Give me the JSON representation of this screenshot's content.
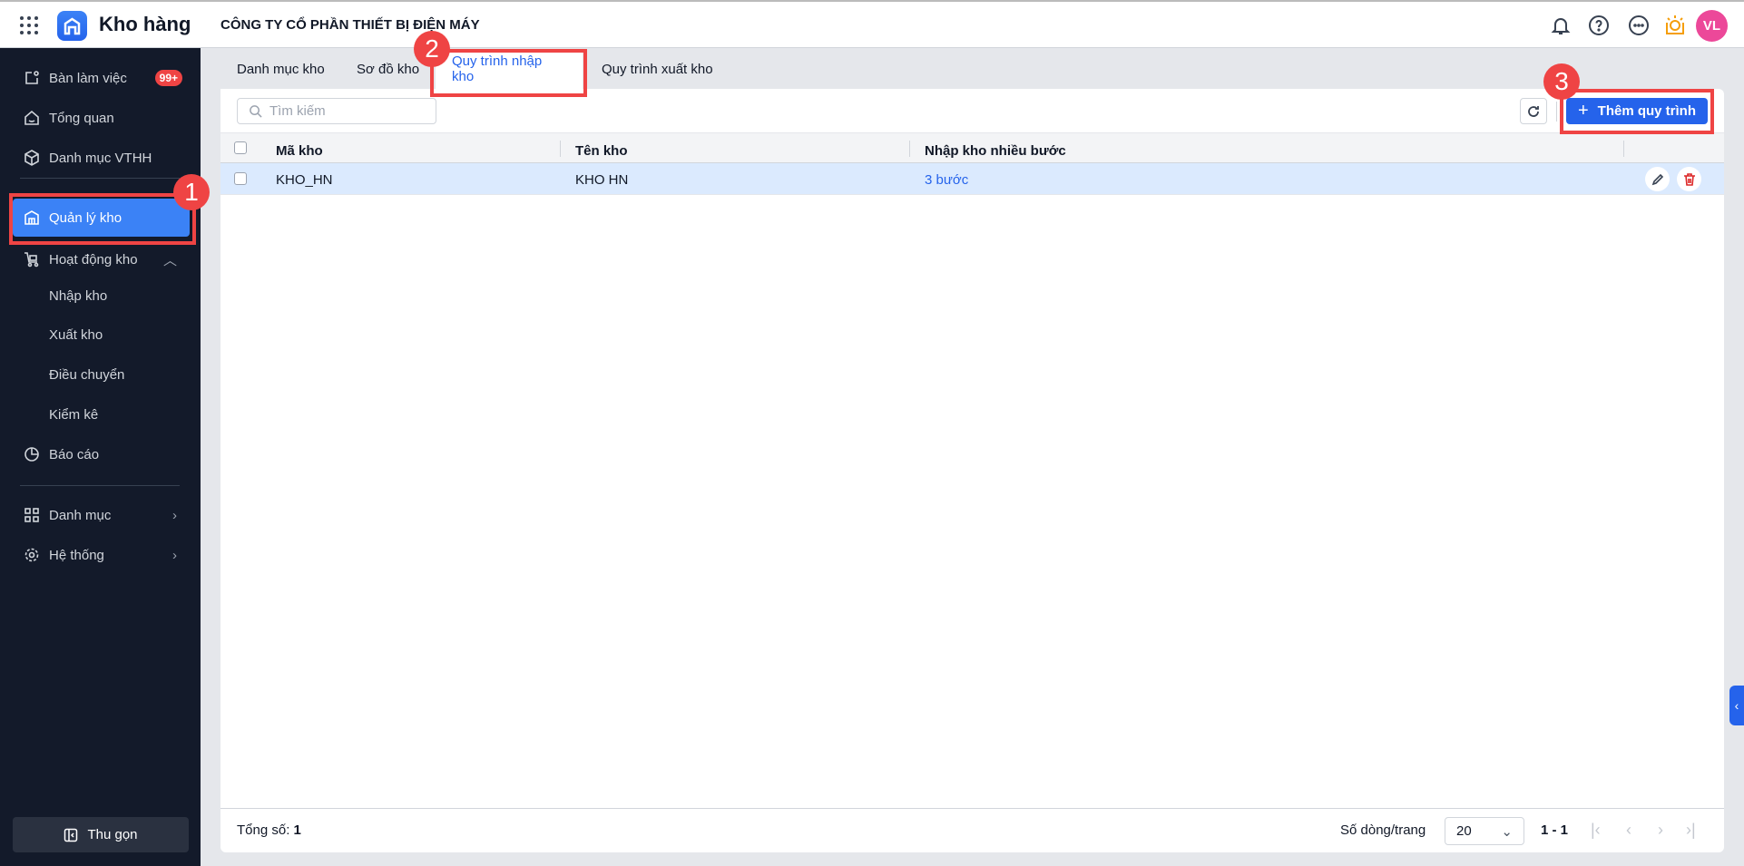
{
  "header": {
    "app_name": "Kho hàng",
    "company": "CÔNG TY CỔ PHẦN THIẾT BỊ ĐIỆN MÁY",
    "avatar": "VL"
  },
  "sidebar": {
    "items": [
      {
        "label": "Bàn làm việc",
        "badge": "99+"
      },
      {
        "label": "Tổng quan"
      },
      {
        "label": "Danh mục VTHH"
      },
      {
        "label": "Quản lý kho"
      },
      {
        "label": "Hoạt động kho"
      },
      {
        "label": "Nhập kho"
      },
      {
        "label": "Xuất kho"
      },
      {
        "label": "Điều chuyển"
      },
      {
        "label": "Kiểm kê"
      },
      {
        "label": "Báo cáo"
      },
      {
        "label": "Danh mục"
      },
      {
        "label": "Hệ thống"
      }
    ],
    "collapse": "Thu gọn"
  },
  "tabs": [
    "Danh mục kho",
    "Sơ đồ kho",
    "Quy trình nhập kho",
    "Quy trình xuất kho"
  ],
  "toolbar": {
    "search_placeholder": "Tìm kiếm",
    "add_label": "Thêm quy trình"
  },
  "table": {
    "columns": [
      "Mã kho",
      "Tên kho",
      "Nhập kho nhiều bước"
    ],
    "rows": [
      {
        "code": "KHO_HN",
        "name": "KHO HN",
        "steps": "3 bước"
      }
    ]
  },
  "footer": {
    "total_label": "Tổng số:",
    "total": "1",
    "rows_label": "Số dòng/trang",
    "page_size": "20",
    "range": "1 - 1"
  },
  "annotations": [
    "1",
    "2",
    "3"
  ],
  "colors": {
    "accent": "#2563eb",
    "sidebar": "#131a2a",
    "highlight": "#ef4444"
  }
}
